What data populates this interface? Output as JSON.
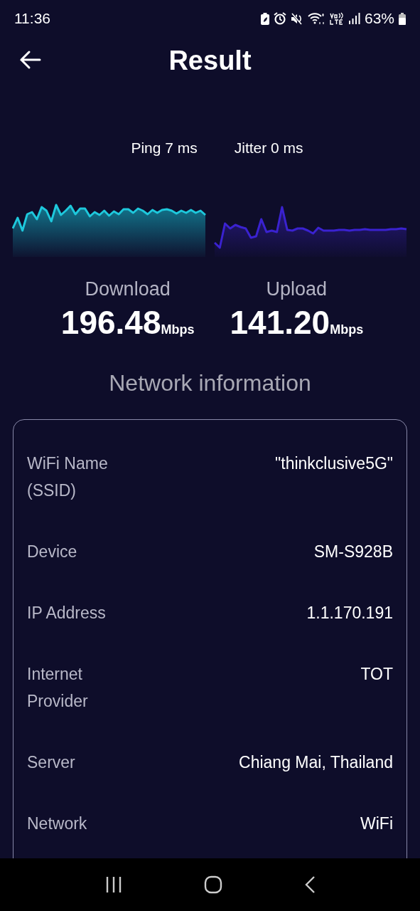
{
  "status_bar": {
    "time": "11:36",
    "battery": "63%"
  },
  "header": {
    "title": "Result"
  },
  "stats": [
    {
      "label": "Ping 7 ms"
    },
    {
      "label": "Jitter 0 ms"
    }
  ],
  "results": [
    {
      "label": "Download",
      "value": "196.48",
      "unit": "Mbps"
    },
    {
      "label": "Upload",
      "value": "141.20",
      "unit": "Mbps"
    }
  ],
  "network_info": {
    "title": "Network information",
    "rows": [
      {
        "label": "WiFi Name (SSID)",
        "value": "\"thinkclusive5G\""
      },
      {
        "label": "Device",
        "value": "SM-S928B"
      },
      {
        "label": "IP Address",
        "value": "1.1.170.191"
      },
      {
        "label": "Internet Provider",
        "value": "TOT"
      },
      {
        "label": "Server",
        "value": "Chiang Mai, Thailand"
      },
      {
        "label": "Network",
        "value": "WiFi"
      }
    ]
  }
}
